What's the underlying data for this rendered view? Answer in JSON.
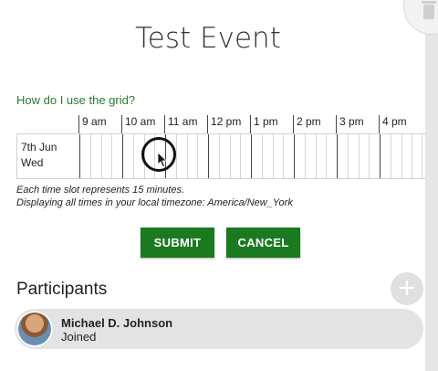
{
  "event": {
    "title": "Test Event"
  },
  "help": {
    "link_text": "How do I use the grid?"
  },
  "grid": {
    "hours": [
      "9 am",
      "10 am",
      "11 am",
      "12 pm",
      "1 pm",
      "2 pm",
      "3 pm",
      "4 pm"
    ],
    "day": {
      "date": "7th Jun",
      "weekday": "Wed"
    },
    "slot_note": "Each time slot represents 15 minutes.",
    "timezone_note": "Displaying all times in your local timezone: America/New_York"
  },
  "buttons": {
    "submit": "SUBMIT",
    "cancel": "CANCEL"
  },
  "participants": {
    "title": "Participants",
    "add_symbol": "+",
    "items": [
      {
        "name": "Michael D. Johnson",
        "status": "Joined"
      }
    ]
  },
  "colors": {
    "accent": "#1b7a1f",
    "link": "#2a7a33"
  }
}
